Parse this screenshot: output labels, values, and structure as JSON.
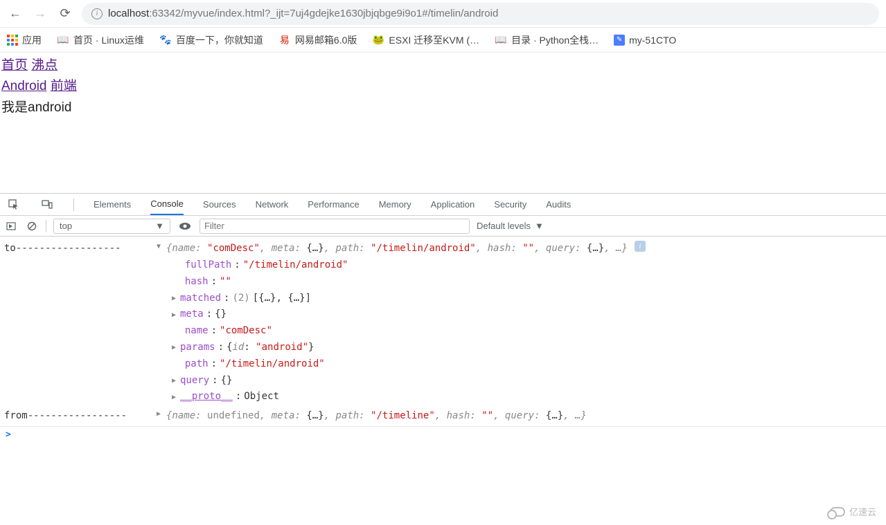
{
  "browser": {
    "url_host": "localhost",
    "url_rest": ":63342/myvue/index.html?_ijt=7uj4gdejke1630jbjqbge9i9o1#/timelin/android"
  },
  "bookmarks": {
    "apps": "应用",
    "items": [
      {
        "label": "首页 · Linux运维"
      },
      {
        "label": "百度一下，你就知道"
      },
      {
        "label": "网易邮箱6.0版"
      },
      {
        "label": "ESXI 迁移至KVM (…"
      },
      {
        "label": "目录 · Python全栈…"
      },
      {
        "label": "my-51CTO"
      }
    ]
  },
  "page": {
    "link_home": "首页",
    "link_boiling": "沸点",
    "link_android": "Android",
    "link_frontend": "前端",
    "content_text": "我是android"
  },
  "devtools": {
    "tabs": {
      "elements": "Elements",
      "console": "Console",
      "sources": "Sources",
      "network": "Network",
      "performance": "Performance",
      "memory": "Memory",
      "application": "Application",
      "security": "Security",
      "audits": "Audits"
    },
    "filterbar": {
      "context": "top",
      "filter_placeholder": "Filter",
      "levels": "Default levels"
    },
    "console": {
      "label_to": "to------------------",
      "label_from": "from-----------------",
      "to_summary": "{name: \"comDesc\", meta: {…}, path: \"/timelin/android\", hash: \"\", query: {…}, …}",
      "to_props": {
        "fullPath_key": "fullPath",
        "fullPath_val": "\"/timelin/android\"",
        "hash_key": "hash",
        "hash_val": "\"\"",
        "matched_key": "matched",
        "matched_count": "(2)",
        "matched_val": "[{…}, {…}]",
        "meta_key": "meta",
        "meta_val": "{}",
        "name_key": "name",
        "name_val": "\"comDesc\"",
        "params_key": "params",
        "params_val": "{id: \"android\"}",
        "params_inner_key": "id",
        "params_inner_val": "\"android\"",
        "path_key": "path",
        "path_val": "\"/timelin/android\"",
        "query_key": "query",
        "query_val": "{}",
        "proto_key": "__proto__",
        "proto_val": "Object"
      },
      "from_summary": "{name: undefined, meta: {…}, path: \"/timeline\", hash: \"\", query: {…}, …}",
      "prompt": ">"
    }
  },
  "watermark": "亿速云"
}
